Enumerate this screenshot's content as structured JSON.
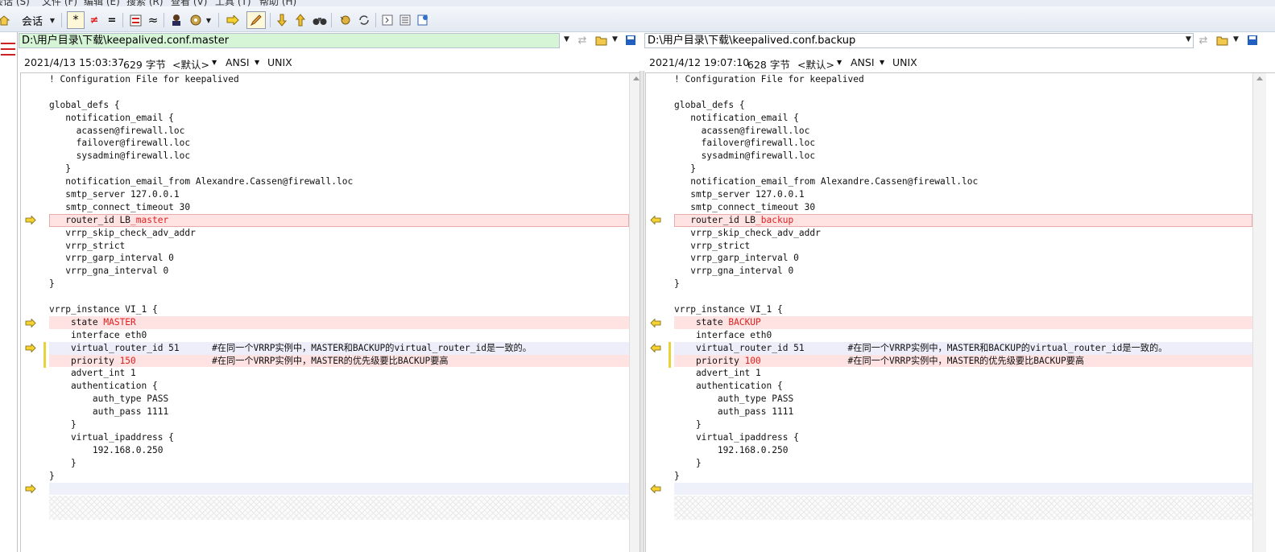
{
  "menu": [
    "会话 (S)",
    "文件 (F)",
    "编辑 (E)",
    "搜索 (R)",
    "查看 (V)",
    "工具 (T)",
    "帮助 (H)"
  ],
  "toolbar": {
    "session_label": "会话",
    "icons": [
      "home-icon",
      "session-dropdown",
      "show-all-icon",
      "show-differences-icon",
      "show-same-icon",
      "swap-icon",
      "ignore-whitespace-icon",
      "rules-icon",
      "format-icon",
      "next-arrow-icon",
      "edit-pencil-icon",
      "next-difference-icon",
      "prev-difference-icon",
      "find-icon",
      "bookmark-icon",
      "refresh-icon",
      "expand-icon",
      "list-icon",
      "report-icon"
    ]
  },
  "left": {
    "path": "D:\\用户目录\\下载\\keepalived.conf.master",
    "timestamp": "2021/4/13 15:03:37",
    "size": "629 字节",
    "format": "<默认>",
    "encoding": "ANSI",
    "line_ending": "UNIX",
    "lines": [
      {
        "t": "! Configuration File for keepalived"
      },
      {
        "t": ""
      },
      {
        "t": "global_defs {"
      },
      {
        "t": "   notification_email {"
      },
      {
        "t": "     acassen@firewall.loc"
      },
      {
        "t": "     failover@firewall.loc"
      },
      {
        "t": "     sysadmin@firewall.loc"
      },
      {
        "t": "   }"
      },
      {
        "t": "   notification_email_from Alexandre.Cassen@firewall.loc"
      },
      {
        "t": "   smtp_server 127.0.0.1"
      },
      {
        "t": "   smtp_connect_timeout 30"
      },
      {
        "t": "   router_id LB",
        "r": "_master",
        "diff": true,
        "boxed": true,
        "arrow": true
      },
      {
        "t": "   vrrp_skip_check_adv_addr"
      },
      {
        "t": "   vrrp_strict"
      },
      {
        "t": "   vrrp_garp_interval 0"
      },
      {
        "t": "   vrrp_gna_interval 0"
      },
      {
        "t": "}"
      },
      {
        "t": ""
      },
      {
        "t": "vrrp_instance VI_1 {"
      },
      {
        "t": "    state ",
        "r": "MASTER",
        "diff": true,
        "arrow": true
      },
      {
        "t": "    interface eth0"
      },
      {
        "t": "    virtual_router_id 51      #在同一个VRRP实例中，MASTER和BACKUP的virtual_router_id是一致的。",
        "cmt": true,
        "arrow": true,
        "mark": true
      },
      {
        "t": "    priority ",
        "r": "150",
        "t2": "              #在同一个VRRP实例中，MASTER的优先级要比BACKUP要高",
        "diff": true,
        "mark": true
      },
      {
        "t": "    advert_int 1"
      },
      {
        "t": "    authentication {"
      },
      {
        "t": "        auth_type PASS"
      },
      {
        "t": "        auth_pass 1111"
      },
      {
        "t": "    }"
      },
      {
        "t": "    virtual_ipaddress {"
      },
      {
        "t": "        192.168.0.250"
      },
      {
        "t": "    }"
      },
      {
        "t": "}"
      },
      {
        "t": "",
        "empty": true,
        "arrow": true
      }
    ]
  },
  "right": {
    "path": "D:\\用户目录\\下载\\keepalived.conf.backup",
    "timestamp": "2021/4/12 19:07:10",
    "size": "628 字节",
    "format": "<默认>",
    "encoding": "ANSI",
    "line_ending": "UNIX",
    "lines": [
      {
        "t": "! Configuration File for keepalived"
      },
      {
        "t": ""
      },
      {
        "t": "global_defs {"
      },
      {
        "t": "   notification_email {"
      },
      {
        "t": "     acassen@firewall.loc"
      },
      {
        "t": "     failover@firewall.loc"
      },
      {
        "t": "     sysadmin@firewall.loc"
      },
      {
        "t": "   }"
      },
      {
        "t": "   notification_email_from Alexandre.Cassen@firewall.loc"
      },
      {
        "t": "   smtp_server 127.0.0.1"
      },
      {
        "t": "   smtp_connect_timeout 30"
      },
      {
        "t": "   router_id LB",
        "r": "_backup",
        "diff": true,
        "boxed": true,
        "arrow": true
      },
      {
        "t": "   vrrp_skip_check_adv_addr"
      },
      {
        "t": "   vrrp_strict"
      },
      {
        "t": "   vrrp_garp_interval 0"
      },
      {
        "t": "   vrrp_gna_interval 0"
      },
      {
        "t": "}"
      },
      {
        "t": ""
      },
      {
        "t": "vrrp_instance VI_1 {"
      },
      {
        "t": "    state ",
        "r": "BACKUP",
        "diff": true,
        "arrow": true
      },
      {
        "t": "    interface eth0"
      },
      {
        "t": "    virtual_router_id 51        #在同一个VRRP实例中，MASTER和BACKUP的virtual_router_id是一致的。",
        "cmt": true,
        "arrow": true,
        "mark": true
      },
      {
        "t": "    priority ",
        "r": "100",
        "t2": "                #在同一个VRRP实例中，MASTER的优先级要比BACKUP要高",
        "diff": true,
        "mark": true
      },
      {
        "t": "    advert_int 1"
      },
      {
        "t": "    authentication {"
      },
      {
        "t": "        auth_type PASS"
      },
      {
        "t": "        auth_pass 1111"
      },
      {
        "t": "    }"
      },
      {
        "t": "    virtual_ipaddress {"
      },
      {
        "t": "        192.168.0.250"
      },
      {
        "t": "    }"
      },
      {
        "t": "}"
      },
      {
        "t": "",
        "empty": true,
        "arrow": true
      }
    ]
  },
  "colors": {
    "diff_bg": "#ffe3e3",
    "diff_text": "#e02020",
    "comment_line_bg": "#eeeefa",
    "left_path_bg": "#d6f5d6",
    "arrow_fill": "#f5d230"
  }
}
